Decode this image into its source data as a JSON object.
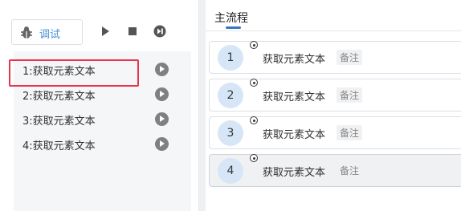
{
  "toolbar": {
    "debug_label": "调试",
    "icons": [
      "bug-icon",
      "play-icon",
      "stop-icon",
      "skip-icon"
    ]
  },
  "steps_list": {
    "items": [
      {
        "label": "1:获取元素文本",
        "selected": true
      },
      {
        "label": "2:获取元素文本",
        "selected": false
      },
      {
        "label": "3:获取元素文本",
        "selected": false
      },
      {
        "label": "4:获取元素文本",
        "selected": false
      }
    ]
  },
  "flow": {
    "title": "主流程",
    "steps": [
      {
        "number": "1",
        "name": "获取元素文本",
        "note": "备注"
      },
      {
        "number": "2",
        "name": "获取元素文本",
        "note": "备注"
      },
      {
        "number": "3",
        "name": "获取元素文本",
        "note": "备注"
      },
      {
        "number": "4",
        "name": "获取元素文本",
        "note": "备注"
      }
    ]
  },
  "colors": {
    "accent": "#3478c6",
    "selection_outline": "#e8344e",
    "step_circle": "#d7e6f7"
  }
}
